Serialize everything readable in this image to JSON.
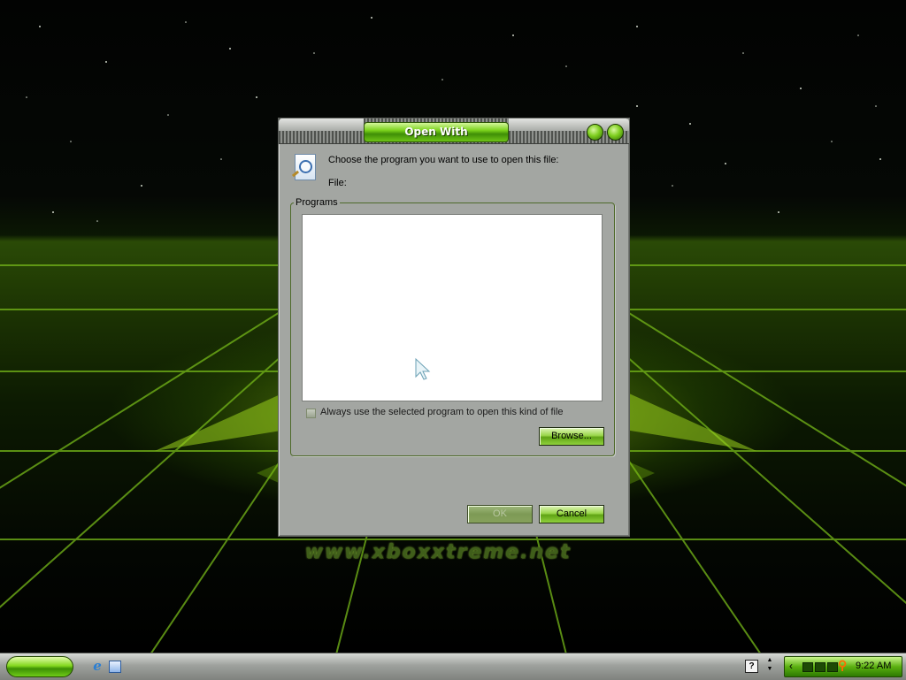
{
  "desktop": {
    "watermark": "www.xboxxtreme.net"
  },
  "dialog": {
    "title": "Open With",
    "prompt": "Choose the program you want to use to open this file:",
    "file_label": "File:",
    "programs_group_label": "Programs",
    "always_use_label": "Always use the selected program to open this kind of file",
    "always_use_checked": false,
    "browse_label": "Browse...",
    "ok_label": "OK",
    "cancel_label": "Cancel",
    "programs": []
  },
  "taskbar": {
    "clock": "9:22 AM",
    "help_label": "?"
  },
  "colors": {
    "accent_green": "#7bd21c",
    "dialog_gray": "#a3a6a2"
  }
}
